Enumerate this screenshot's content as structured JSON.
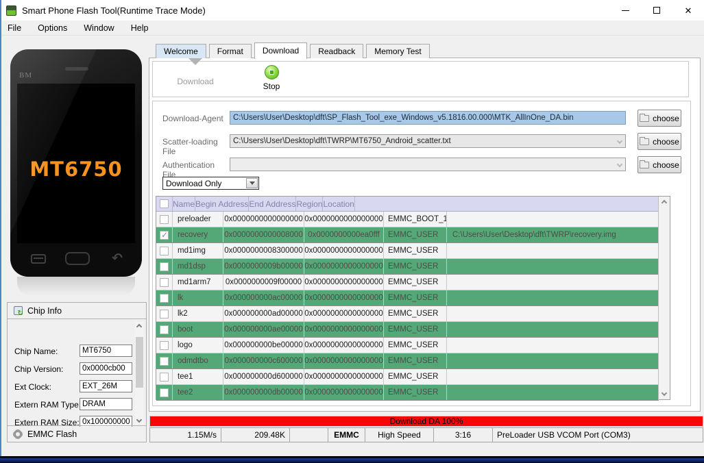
{
  "colors": {
    "row-green": "#54a878",
    "header-lavender": "#d8d8f0",
    "field-blue": "#a8c8e8",
    "progress-red": "#f80505",
    "accent-orange": "#f79220"
  },
  "window": {
    "title": "Smart Phone Flash Tool(Runtime Trace Mode)"
  },
  "menu": {
    "items": [
      "File",
      "Options",
      "Window",
      "Help"
    ]
  },
  "left_panel": {
    "phone": {
      "brand": "BM",
      "chip": "MT6750",
      "back_glyph": "↶"
    },
    "chip_info": {
      "title": "Chip Info",
      "fields": [
        {
          "label": "Chip Name:",
          "value": "MT6750"
        },
        {
          "label": "Chip Version:",
          "value": "0x0000cb00"
        },
        {
          "label": "Ext Clock:",
          "value": "EXT_26M"
        },
        {
          "label": "Extern RAM Type:",
          "value": "DRAM"
        },
        {
          "label": "Extern RAM Size:",
          "value": "0x100000000"
        }
      ],
      "footer": "EMMC Flash"
    }
  },
  "tabs": {
    "items": [
      {
        "label": "Welcome",
        "active": false,
        "tint": true
      },
      {
        "label": "Format",
        "active": false,
        "tint": false
      },
      {
        "label": "Download",
        "active": true,
        "tint": false
      },
      {
        "label": "Readback",
        "active": false,
        "tint": false
      },
      {
        "label": "Memory Test",
        "active": false,
        "tint": false
      }
    ]
  },
  "toolbar": {
    "download_label": "Download",
    "stop_label": "Stop"
  },
  "form": {
    "download_agent": {
      "label": "Download-Agent",
      "value": "C:\\Users\\User\\Desktop\\dft\\SP_Flash_Tool_exe_Windows_v5.1816.00.000\\MTK_AllInOne_DA.bin"
    },
    "scatter_file": {
      "label": "Scatter-loading File",
      "value": "C:\\Users\\User\\Desktop\\dft\\TWRP\\MT6750_Android_scatter.txt"
    },
    "auth_file": {
      "label": "Authentication File",
      "value": ""
    },
    "choose_label": "choose",
    "mode_select": {
      "value": "Download Only"
    }
  },
  "table": {
    "columns": [
      "Name",
      "Begin Address",
      "End Address",
      "Region",
      "Location"
    ],
    "rows": [
      {
        "name": "preloader",
        "begin": "0x0000000000000000",
        "end": "0x0000000000000000",
        "region": "EMMC_BOOT_1",
        "location": "",
        "checked": false,
        "highlighted": false
      },
      {
        "name": "recovery",
        "begin": "0x0000000000008000",
        "end": "0x0000000000ea0fff",
        "region": "EMMC_USER",
        "location": "C:\\Users\\User\\Desktop\\dft\\TWRP\\recovery.img",
        "checked": true,
        "highlighted": true
      },
      {
        "name": "md1img",
        "begin": "0x0000000008300000",
        "end": "0x0000000000000000",
        "region": "EMMC_USER",
        "location": "",
        "checked": false,
        "highlighted": false
      },
      {
        "name": "md1dsp",
        "begin": "0x0000000009b00000",
        "end": "0x0000000000000000",
        "region": "EMMC_USER",
        "location": "",
        "checked": false,
        "highlighted": true
      },
      {
        "name": "md1arm7",
        "begin": "0x0000000009f00000",
        "end": "0x0000000000000000",
        "region": "EMMC_USER",
        "location": "",
        "checked": false,
        "highlighted": false
      },
      {
        "name": "lk",
        "begin": "0x000000000ac00000",
        "end": "0x0000000000000000",
        "region": "EMMC_USER",
        "location": "",
        "checked": false,
        "highlighted": true
      },
      {
        "name": "lk2",
        "begin": "0x000000000ad00000",
        "end": "0x0000000000000000",
        "region": "EMMC_USER",
        "location": "",
        "checked": false,
        "highlighted": false
      },
      {
        "name": "boot",
        "begin": "0x000000000ae00000",
        "end": "0x0000000000000000",
        "region": "EMMC_USER",
        "location": "",
        "checked": false,
        "highlighted": true
      },
      {
        "name": "logo",
        "begin": "0x000000000be00000",
        "end": "0x0000000000000000",
        "region": "EMMC_USER",
        "location": "",
        "checked": false,
        "highlighted": false
      },
      {
        "name": "odmdtbo",
        "begin": "0x000000000c600000",
        "end": "0x0000000000000000",
        "region": "EMMC_USER",
        "location": "",
        "checked": false,
        "highlighted": true
      },
      {
        "name": "tee1",
        "begin": "0x000000000d600000",
        "end": "0x0000000000000000",
        "region": "EMMC_USER",
        "location": "",
        "checked": false,
        "highlighted": false
      },
      {
        "name": "tee2",
        "begin": "0x000000000db00000",
        "end": "0x0000000000000000",
        "region": "EMMC_USER",
        "location": "",
        "checked": false,
        "highlighted": true
      }
    ]
  },
  "progress": {
    "label": "Download DA 100%"
  },
  "status_bar": {
    "speed": "1.15M/s",
    "size": "209.48K",
    "blank": "",
    "storage": "EMMC",
    "mode": "High Speed",
    "time": "3:16",
    "port": "PreLoader USB VCOM Port (COM3)"
  }
}
